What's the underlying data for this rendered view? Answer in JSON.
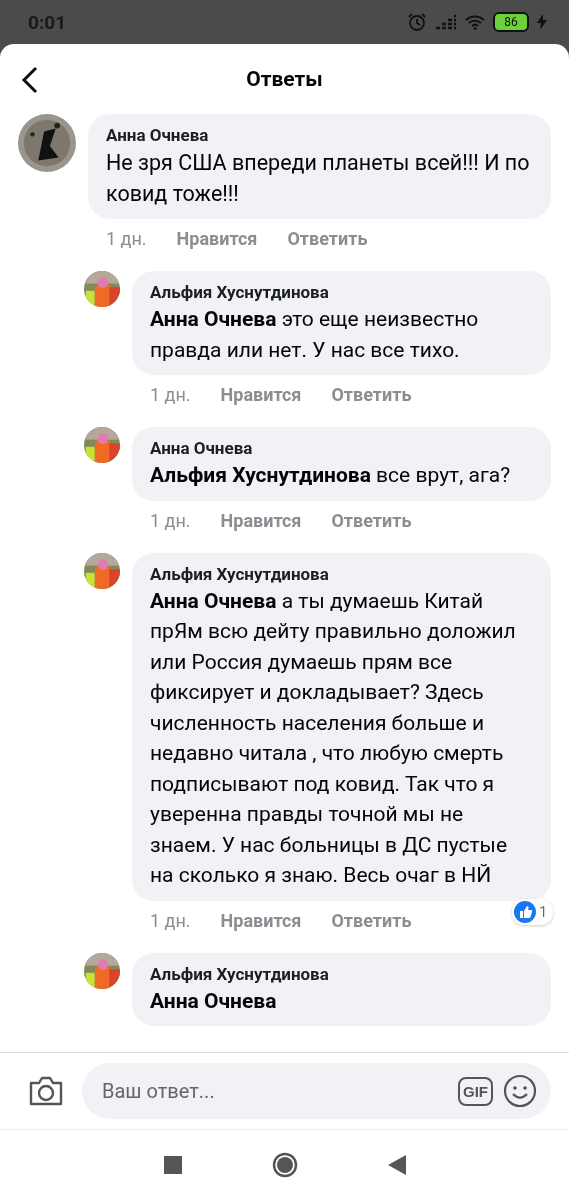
{
  "status_bar": {
    "time": "0:01",
    "battery": "86"
  },
  "header": {
    "title": "Ответы"
  },
  "comment": {
    "author": "Анна Очнева",
    "text": "Не зря США впереди планеты всей!!! И по ковид тоже!!!",
    "time": "1 дн.",
    "like": "Нравится",
    "reply": "Ответить",
    "children": [
      {
        "author": "Альфия Хуснутдинова",
        "text": "**Анна Очнева** это еще неизвестно правда или нет. У нас все тихо.",
        "time": "1 дн.",
        "like": "Нравится",
        "reply": "Ответить"
      },
      {
        "author": "Анна Очнева",
        "text": "**Альфия Хуснутдинова** все врут, ага?",
        "time": "1 дн.",
        "like": "Нравится",
        "reply": "Ответить"
      },
      {
        "author": "Альфия Хуснутдинова",
        "text": "**Анна Очнева** а ты думаешь Китай прЯм всю дейту правильно доложил или Россия думаешь прям все фиксирует и докладывает? Здесь численность населения больше и недавно читала , что любую смерть подписывают под ковид. Так что я уверенна правды точной мы не знаем. У нас больницы в ДС пустые на сколько я знаю. Весь очаг в НЙ",
        "time": "1 дн.",
        "like": "Нравится",
        "reply": "Ответить",
        "reactions": "1"
      },
      {
        "author": "Альфия Хуснутдинова",
        "text": "**Анна Очнева**"
      }
    ]
  },
  "composer": {
    "placeholder": "Ваш ответ...",
    "gif": "GIF"
  }
}
